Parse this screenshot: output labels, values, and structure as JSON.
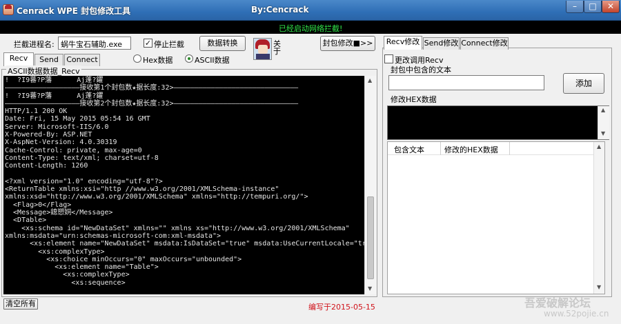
{
  "window": {
    "title": "Cenrack WPE 封包修改工具",
    "author": "By:Cencrack",
    "minimize_glyph": "–",
    "maximize_glyph": "□",
    "close_glyph": "✕"
  },
  "status": {
    "message": "已经启动网络拦截!",
    "color": "#31e84a"
  },
  "toolbar": {
    "process_label": "拦截进程名:",
    "process_value": "蜗牛宝石辅助.exe",
    "stop_intercept_label": "停止拦截",
    "stop_intercept_checked": true,
    "convert_button": "数据转换",
    "about_label": "关于",
    "packet_modify_button": "封包修改■>>"
  },
  "left_tabs": [
    "Recv",
    "Send",
    "Connect"
  ],
  "left_tabs_active": 0,
  "display_mode": {
    "hex_label": "Hex数据",
    "ascii_label": "ASCII数据",
    "selected": "ascii"
  },
  "groupbox_title": "ASCII数据数据_Recv",
  "console_lines": [
    "!  ?I9蕃?P藩      Aj蓬?鑺",
    "——————————————————接收第1个封包数★据长度:32>——————————————————————————————",
    "!  ?I9蕃?P藩      Aj蓬?鑺",
    "——————————————————接收第2个封包数★据长度:32>——————————————————————————————",
    "HTTP/1.1 200 OK",
    "Date: Fri, 15 May 2015 05:54 16 GMT",
    "Server: Microsoft-IIS/6.0",
    "X-Powered-By: ASP.NET",
    "X-AspNet-Version: 4.0.30319",
    "Cache-Control: private, max-age=0",
    "Content-Type: text/xml; charset=utf-8",
    "Content-Length: 1260",
    "",
    "<?xml version=\"1.0\" encoding=\"utf-8\"?>",
    "<ReturnTable xmlns:xsi=\"http //www.w3.org/2001/XMLSchema-instance\"",
    "xmlns:xsd=\"http://www.w3.org/2001/XMLSchema\" xmlns=\"http://tempuri.org/\">",
    "  <Flag>0</Flag>",
    "  <Message>鎴愬姛</Message>",
    "  <DTable>",
    "    <xs:schema id=\"NewDataSet\" xmlns=\"\" xmlns xs=\"http://www.w3.org/2001/XMLSchema\"",
    "xmlns:msdata=\"urn:schemas-microsoft-com:xml-msdata\">",
    "      <xs:element name=\"NewDataSet\" msdata:IsDataSet=\"true\" msdata:UseCurrentLocale=\"true\">",
    "        <xs:complexType>",
    "          <xs:choice minOccurs=\"0\" maxOccurs=\"unbounded\">",
    "            <xs:element name=\"Table\">",
    "              <xs:complexType>",
    "                <xs:sequence>"
  ],
  "clear_button": "清空所有",
  "compile_date": "编写于2015-05-15",
  "right_tabs": [
    "Recv修改",
    "Send修改",
    "Connect修改"
  ],
  "right_tabs_active": 0,
  "right_panel": {
    "change_recv_label": "更改调用Recv",
    "change_recv_checked": false,
    "contains_text_label": "封包中包含的文本",
    "contains_text_value": "",
    "add_button": "添加",
    "modify_hex_label": "修改HEX数据",
    "list_columns": [
      "包含文本",
      "修改的HEX数据"
    ]
  },
  "watermark": {
    "line1": "吾爱破解论坛",
    "line2": "www.52pojie.cn"
  }
}
